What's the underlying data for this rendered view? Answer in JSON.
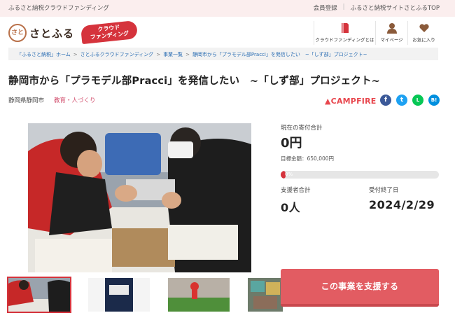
{
  "topbar": {
    "tagline": "ふるさと納税クラウドファンディング",
    "links": [
      "会員登録",
      "ふるさと納税サイトさとふるTOP"
    ]
  },
  "header": {
    "logo_mark": "さと",
    "logo_text": "さとふる",
    "badge_line1": "クラウド",
    "badge_line2": "ファンディング",
    "nav": [
      {
        "label": "クラウドファンディングとは",
        "icon": "book-icon"
      },
      {
        "label": "マイページ",
        "icon": "user-icon"
      },
      {
        "label": "お気に入り",
        "icon": "heart-icon"
      }
    ]
  },
  "breadcrumbs": [
    "「ふるさと納税」ホーム",
    "さとふるクラウドファンディング",
    "事業一覧",
    "静岡市から「プラモデル部Pracci」を発信したい　~「しず部」プロジェクト~"
  ],
  "project": {
    "title": "静岡市から「プラモデル部Pracci」を発信したい　~「しず部」プロジェクト~",
    "location": "静岡県静岡市",
    "category": "教育・人づくり",
    "platform": "CAMPFIRE"
  },
  "share": [
    {
      "icon": "facebook-icon",
      "glyph": "f",
      "color": "#3b5998"
    },
    {
      "icon": "twitter-icon",
      "glyph": "t",
      "color": "#1da1f2"
    },
    {
      "icon": "line-icon",
      "glyph": "L",
      "color": "#06c755"
    },
    {
      "icon": "hatena-icon",
      "glyph": "B!",
      "color": "#008fde"
    }
  ],
  "stats": {
    "current_label": "現在の寄付合計",
    "current_value": "0円",
    "goal_label": "目標金額：650,000円",
    "progress_text": "0%",
    "progress_fraction": 0.03,
    "supporters_label": "支援者合計",
    "supporters_value": "0人",
    "deadline_label": "受付終了日",
    "deadline_value": "2024/2/29"
  },
  "cta": {
    "label": "この事業を支援する",
    "color": "#e25c62"
  },
  "colors": {
    "accent": "#d5333c",
    "link": "#2a6db3",
    "category": "#d14b6a"
  }
}
